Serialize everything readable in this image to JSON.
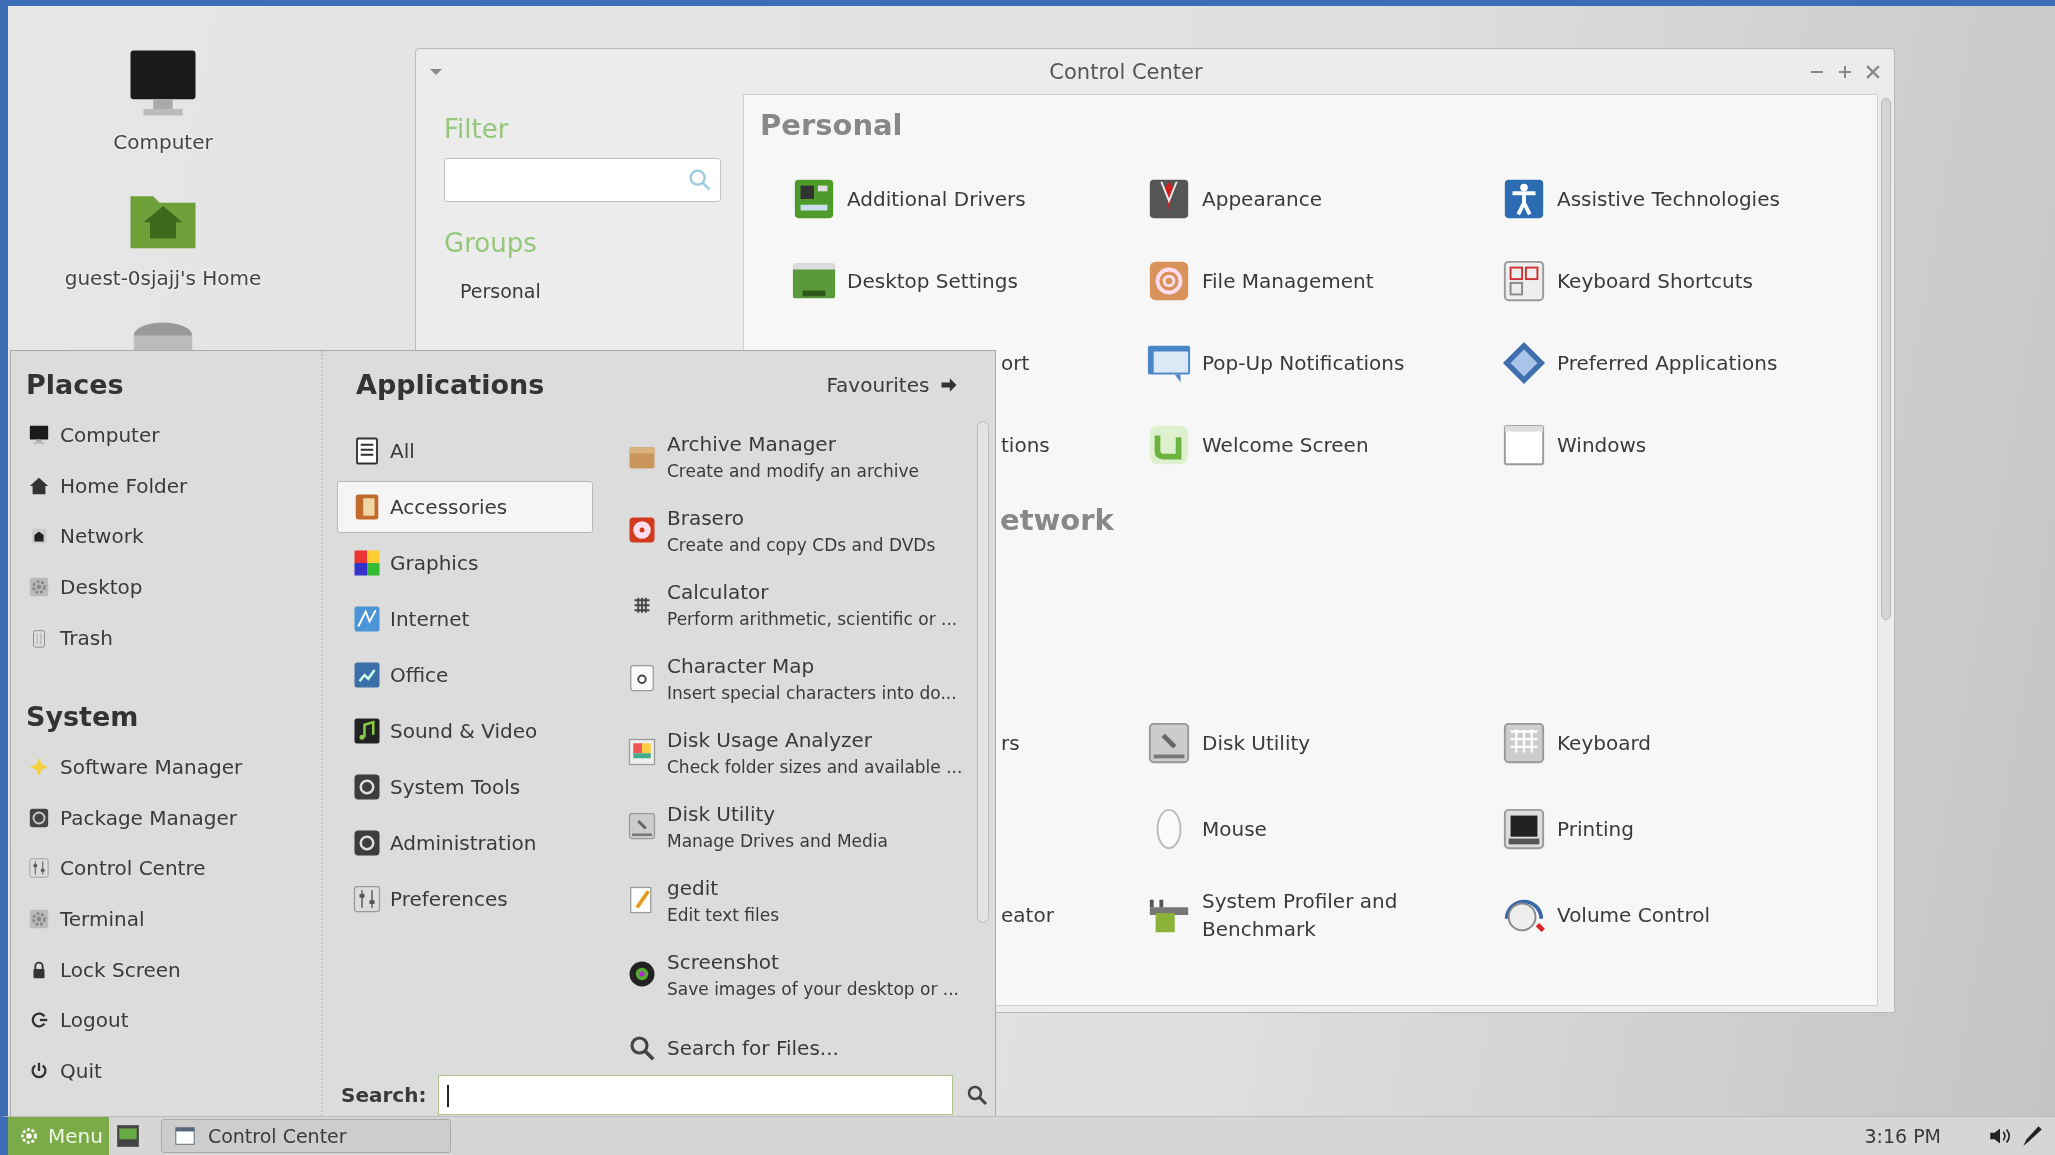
{
  "desktop_icons": [
    {
      "label": "Computer"
    },
    {
      "label": "guest-0sjajj's Home"
    }
  ],
  "control_center": {
    "title": "Control Center",
    "filter_heading": "Filter",
    "groups_heading": "Groups",
    "groups": [
      {
        "label": "Personal"
      }
    ],
    "personal": {
      "heading": "Personal",
      "rows": [
        {
          "items": [
            {
              "label": "Additional Drivers"
            },
            {
              "label": "Appearance"
            },
            {
              "label": "Assistive Technologies"
            }
          ]
        },
        {
          "items": [
            {
              "label": "Desktop Settings"
            },
            {
              "label": "File Management"
            },
            {
              "label": "Keyboard Shortcuts"
            }
          ]
        },
        {
          "partial": "ort",
          "items": [
            {
              "label": "Pop-Up Notifications"
            },
            {
              "label": "Preferred Applications"
            }
          ]
        },
        {
          "partial": "tions",
          "items": [
            {
              "label": "Welcome Screen"
            },
            {
              "label": "Windows"
            }
          ]
        }
      ]
    },
    "network_heading": "etwork",
    "hardware_rows": [
      {
        "partial": "rs",
        "items": [
          {
            "label": "Disk Utility"
          },
          {
            "label": "Keyboard"
          }
        ]
      },
      {
        "items": [
          {
            "label": "Mouse"
          },
          {
            "label": "Printing"
          }
        ]
      },
      {
        "partial": "eator",
        "items": [
          {
            "label": "System Profiler and Benchmark"
          },
          {
            "label": "Volume Control"
          }
        ]
      }
    ]
  },
  "menu": {
    "places_heading": "Places",
    "places": [
      {
        "label": "Computer"
      },
      {
        "label": "Home Folder"
      },
      {
        "label": "Network"
      },
      {
        "label": "Desktop"
      },
      {
        "label": "Trash"
      }
    ],
    "system_heading": "System",
    "system": [
      {
        "label": "Software Manager"
      },
      {
        "label": "Package Manager"
      },
      {
        "label": "Control Centre"
      },
      {
        "label": "Terminal"
      },
      {
        "label": "Lock Screen"
      },
      {
        "label": "Logout"
      },
      {
        "label": "Quit"
      }
    ],
    "applications_heading": "Applications",
    "favourites": "Favourites",
    "categories": [
      {
        "label": "All",
        "selected": false
      },
      {
        "label": "Accessories",
        "selected": true
      },
      {
        "label": "Graphics",
        "selected": false
      },
      {
        "label": "Internet",
        "selected": false
      },
      {
        "label": "Office",
        "selected": false
      },
      {
        "label": "Sound & Video",
        "selected": false
      },
      {
        "label": "System Tools",
        "selected": false
      },
      {
        "label": "Administration",
        "selected": false
      },
      {
        "label": "Preferences",
        "selected": false
      }
    ],
    "apps": [
      {
        "name": "Archive Manager",
        "description": "Create and modify an archive"
      },
      {
        "name": "Brasero",
        "description": "Create and copy CDs and DVDs"
      },
      {
        "name": "Calculator",
        "description": "Perform arithmetic, scientific or ..."
      },
      {
        "name": "Character Map",
        "description": "Insert special characters into do..."
      },
      {
        "name": "Disk Usage Analyzer",
        "description": "Check folder sizes and available ..."
      },
      {
        "name": "Disk Utility",
        "description": "Manage Drives and Media"
      },
      {
        "name": "gedit",
        "description": "Edit text files"
      },
      {
        "name": "Screenshot",
        "description": "Save images of your desktop or ..."
      },
      {
        "name": "Search for Files..."
      }
    ],
    "search_label": "Search:"
  },
  "taskbar": {
    "menu_button": "Menu",
    "tasks": [
      {
        "label": "Control Center"
      }
    ],
    "clock": "3:16 PM"
  }
}
